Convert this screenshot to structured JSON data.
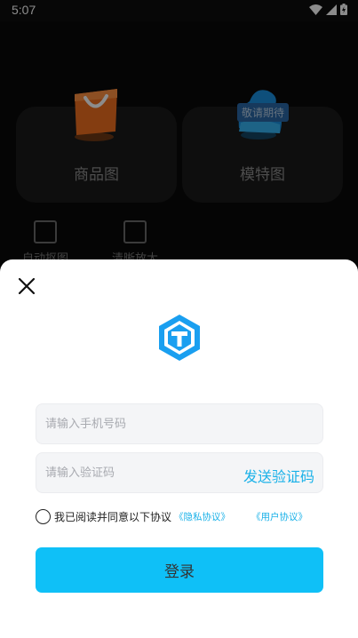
{
  "status_bar": {
    "time": "5:07"
  },
  "background": {
    "cards": [
      {
        "label": "商品图"
      },
      {
        "label": "模特图",
        "badge": "敬请期待"
      }
    ],
    "tools": [
      {
        "label": "自动抠图"
      },
      {
        "label": "清晰放大"
      }
    ]
  },
  "login_sheet": {
    "phone_placeholder": "请输入手机号码",
    "code_placeholder": "请输入验证码",
    "send_code_label": "发送验证码",
    "agreement_text": "我已阅读并同意以下协议",
    "privacy_link": "《隐私协议》",
    "user_link": "《用户协议》",
    "login_label": "登录"
  },
  "colors": {
    "accent": "#0fc0f7",
    "link": "#1ab1e8"
  }
}
